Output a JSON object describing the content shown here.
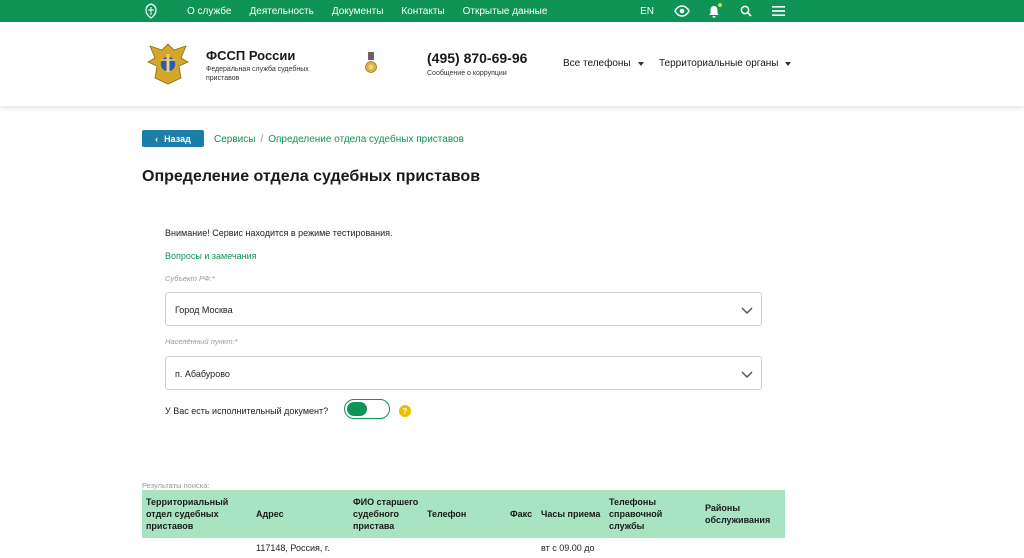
{
  "topbar": {
    "nav": [
      "О службе",
      "Деятельность",
      "Документы",
      "Контакты",
      "Открытые данные"
    ],
    "lang": "EN",
    "icons": [
      "eye-icon",
      "bell-icon",
      "search-icon",
      "menu-icon"
    ],
    "color": "#0f9456"
  },
  "header": {
    "org_name": "ФССП России",
    "org_sub": "Федеральная служба судебных приставов",
    "phone": "(495) 870-69-96",
    "phone_sub": "Сообщение о коррупции",
    "menu_phones": "Все телефоны",
    "menu_regions": "Территориальные органы"
  },
  "breadcrumb": {
    "back": "Назад",
    "items": [
      "Сервисы",
      "Определение отдела судебных приставов"
    ]
  },
  "page": {
    "title": "Определение отдела судебных приставов",
    "notice": "Внимание! Сервис находится в режиме тестирования.",
    "feedback_link": "Вопросы и замечания"
  },
  "form": {
    "subject_label": "Субъект РФ:*",
    "subject_value": "Город Москва",
    "locality_label": "Населённый пункт:*",
    "locality_value": "п. Абабурово",
    "doc_question": "У Вас есть исполнительный документ?",
    "doc_toggle_on": true
  },
  "results": {
    "label": "Результаты поиска:",
    "columns": [
      "Территориальный отдел судебных приставов",
      "Адрес",
      "ФИО старшего судебного пристава",
      "Телефон",
      "Факс",
      "Часы приема",
      "Телефоны справочной службы",
      "Районы обслуживания"
    ],
    "first_row_partial": [
      "",
      "117148, Россия, г.",
      "",
      "",
      "",
      "вт с 09.00 до",
      "",
      ""
    ]
  }
}
